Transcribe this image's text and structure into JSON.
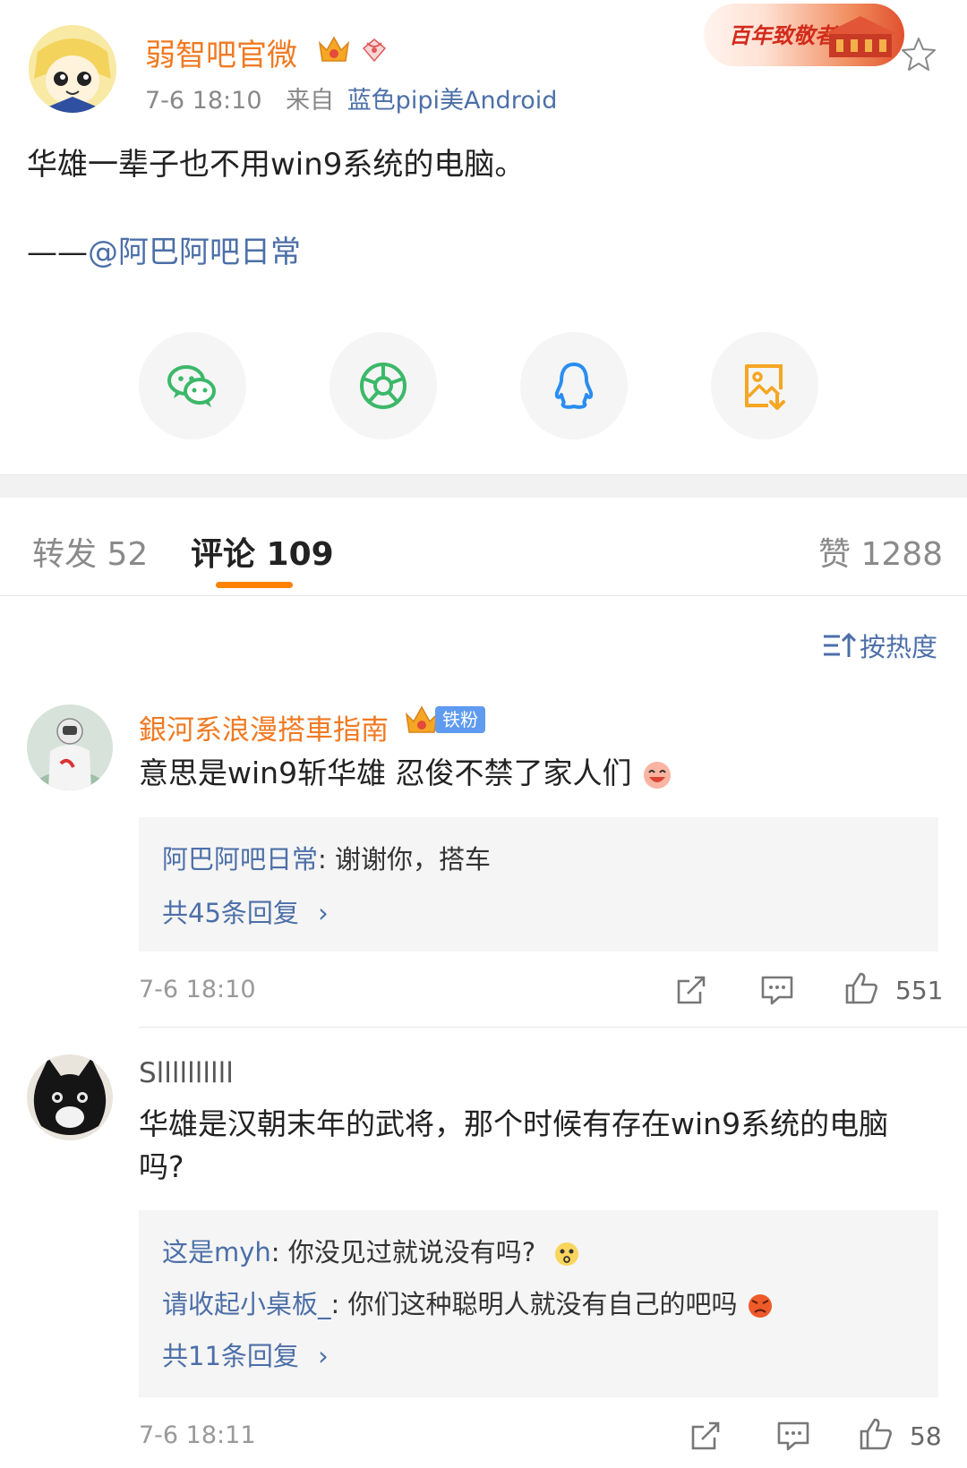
{
  "post": {
    "author": "弱智吧官微",
    "time": "7-6 18:10",
    "source_prefix": "来自",
    "source": "蓝色pipi美Android",
    "event_banner": "百年致敬者",
    "text": "华雄一辈子也不用win9系统的电脑。",
    "mention_dash": "——",
    "mention": "@阿巴阿吧日常",
    "share_icons": [
      "wechat-icon",
      "moments-icon",
      "qq-icon",
      "save-image-icon"
    ]
  },
  "tabs": {
    "repost": "转发 52",
    "comment": "评论 109",
    "like": "赞 1288"
  },
  "sort": {
    "label": "按热度"
  },
  "comments": [
    {
      "user": "銀河系浪漫搭車指南",
      "badge": "铁粉",
      "text": "意思是win9斩华雄 忍俊不禁了家人们",
      "replies": [
        {
          "user": "阿巴阿吧日常",
          "text": ": 谢谢你，搭车"
        }
      ],
      "more": "共45条回复",
      "time": "7-6 18:10",
      "likes": "551"
    },
    {
      "user": "Sllllllllll",
      "text": "华雄是汉朝末年的武将，那个时候有存在win9系统的电脑吗?",
      "replies": [
        {
          "user": "这是myh",
          "text": ": 你没见过就说没有吗?"
        },
        {
          "user": "请收起小桌板_",
          "text": ": 你们这种聪明人就没有自己的吧吗"
        }
      ],
      "more": "共11条回复",
      "time": "7-6 18:11",
      "likes": "58"
    }
  ],
  "colors": {
    "accent_orange": "#ff8200",
    "link_blue": "#4c6fa8",
    "name_orange": "#f07a22"
  }
}
